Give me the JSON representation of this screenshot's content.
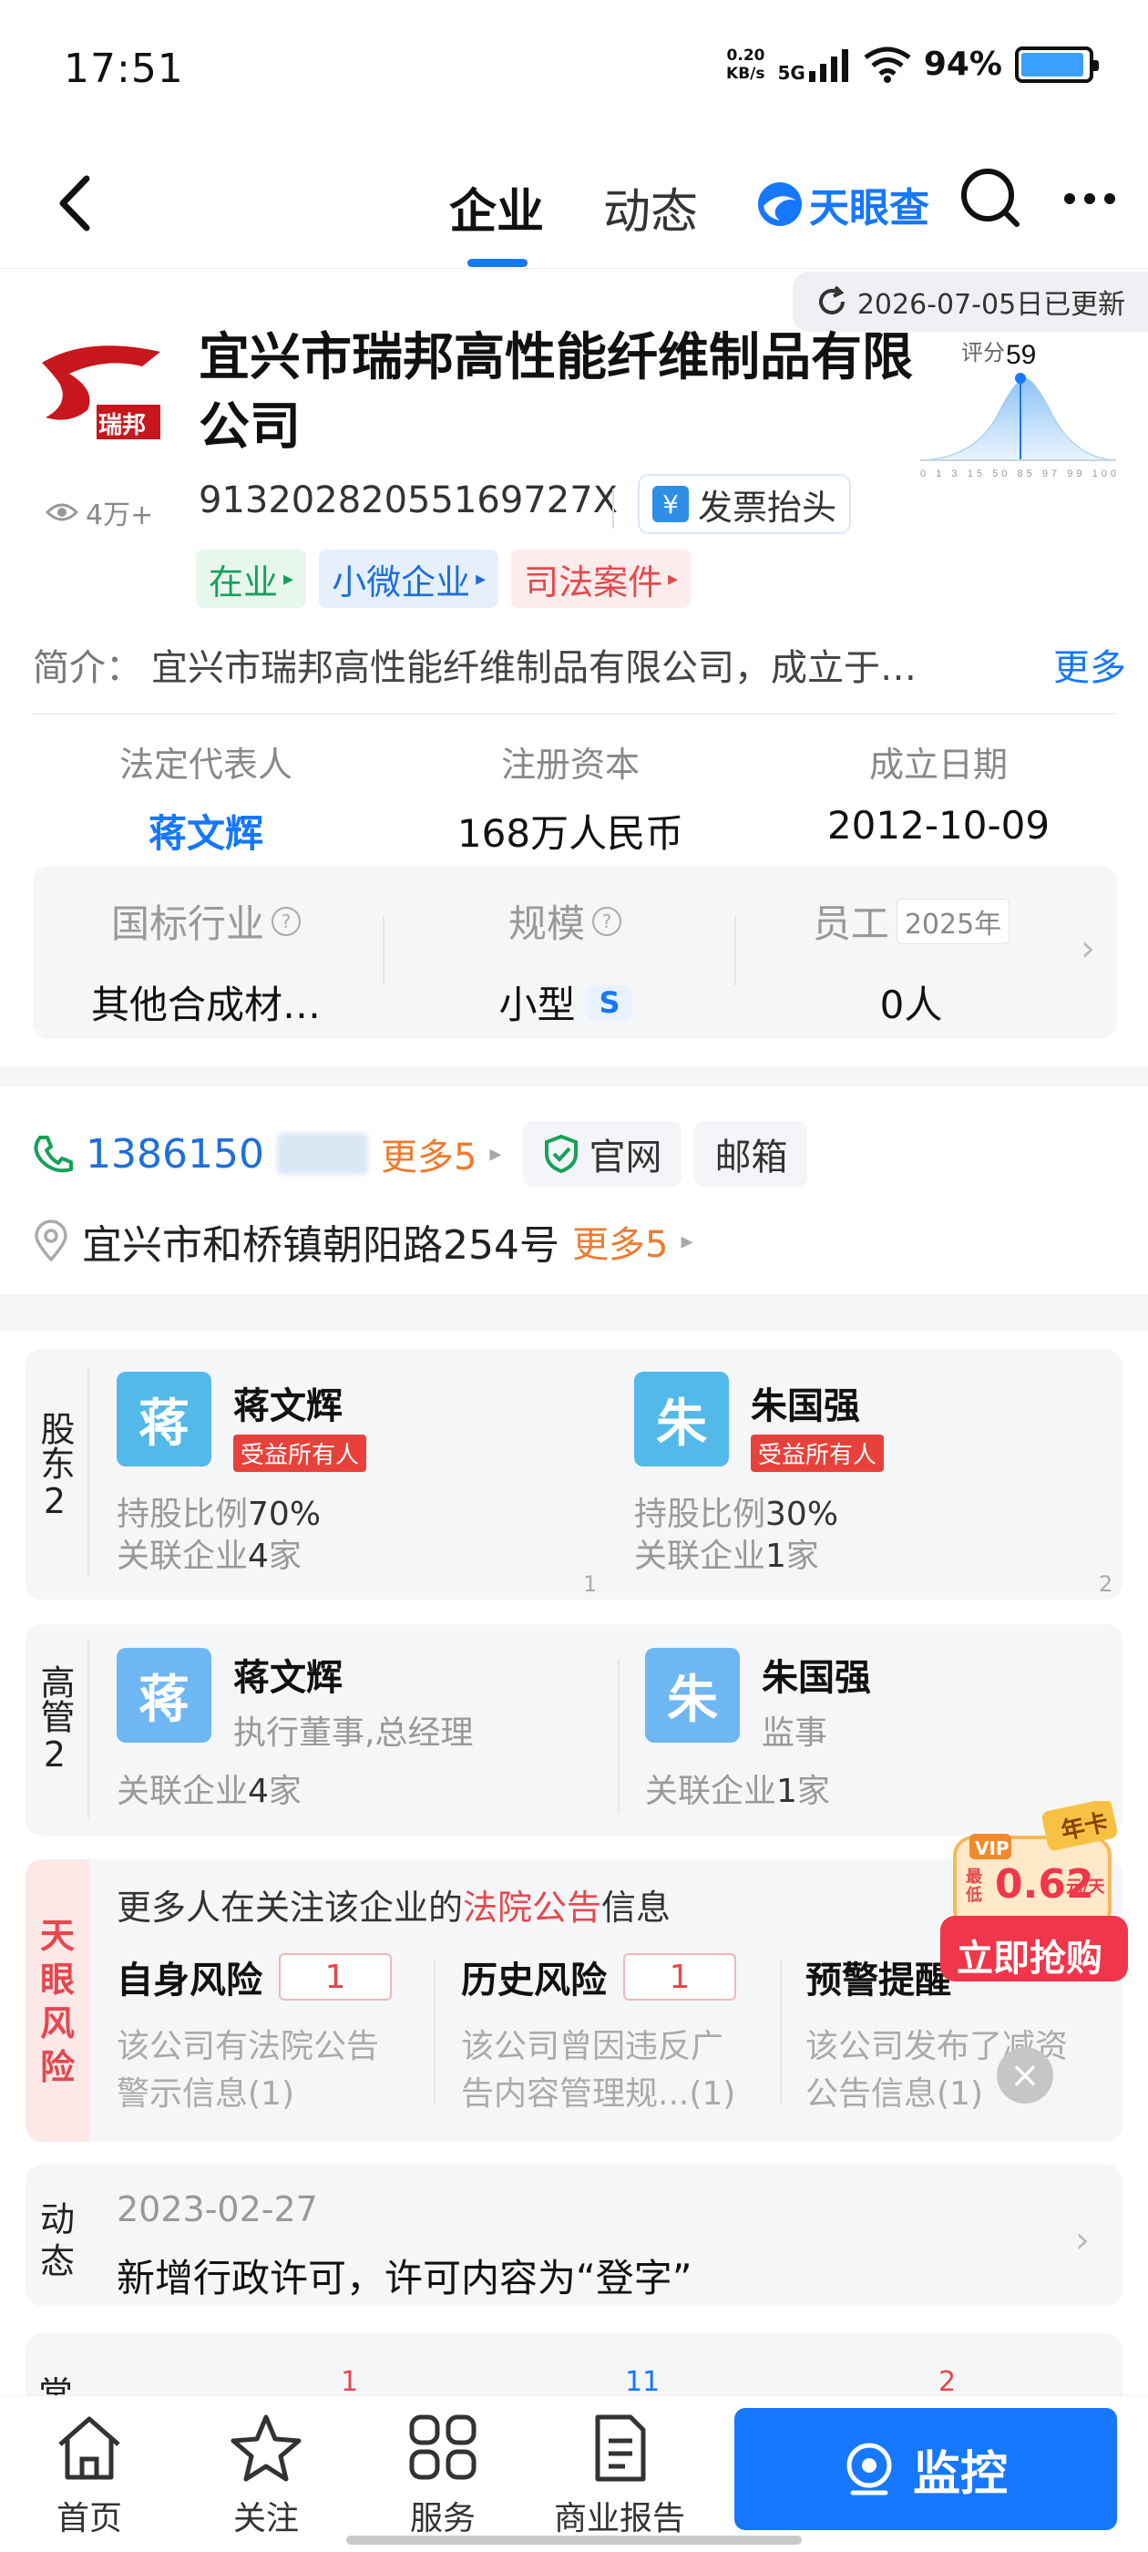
{
  "status": {
    "time": "17:51",
    "net_speed_top": "0.20",
    "net_speed_bottom": "KB/s",
    "signal": "5G",
    "battery": "94%",
    "battery_level": 0.94
  },
  "nav": {
    "tabs": [
      {
        "label": "企业"
      },
      {
        "label": "动态"
      }
    ],
    "brand": "天眼查"
  },
  "company": {
    "updated": "2026-07-05日已更新",
    "name": "宜兴市瑞邦高性能纤维制品有限公司",
    "logo_text": "瑞邦",
    "views": "4万+",
    "credit_code": "913202820551697 27X",
    "credit_code_display": "9132028205516972 7X",
    "credit": "91320282055169727X",
    "invoice_label": "发票抬头",
    "score_label": "评分",
    "score": "59",
    "score_ticks": "0 1 3 15 50 85 97 99 100",
    "tags": [
      {
        "label": "在业",
        "color": "#17a05a"
      },
      {
        "label": "小微企业",
        "color": "#1e6fd9"
      },
      {
        "label": "司法案件",
        "color": "#e5484d"
      }
    ],
    "intro_label": "简介：",
    "intro_text": "宜兴市瑞邦高性能纤维制品有限公司，成立于…",
    "intro_more": "更多",
    "legal_rep_label": "法定代表人",
    "legal_rep": "蒋文辉",
    "capital_label": "注册资本",
    "capital": "168万人民币",
    "founded_label": "成立日期",
    "founded": "2012-10-09",
    "industry_label": "国标行业",
    "industry": "其他合成材…",
    "scale_label": "规模",
    "scale": "小型",
    "scale_badge": "S",
    "staff_label": "员工",
    "staff_year": "2025年",
    "staff": "0人"
  },
  "contact": {
    "phone": "1386150",
    "phone_more": "更多5",
    "website": "官网",
    "email": "邮箱",
    "address": "宜兴市和桥镇朝阳路254号",
    "address_more": "更多5"
  },
  "shareholders": {
    "label": "股东",
    "count": "2",
    "items": [
      {
        "avatar": "蒋",
        "name": "蒋文辉",
        "badge": "受益所有人",
        "ratio_label": "持股比例",
        "ratio": "70%",
        "rel_label": "关联企业",
        "rel": "4",
        "rel_unit": "家",
        "index": "1"
      },
      {
        "avatar": "朱",
        "name": "朱国强",
        "badge": "受益所有人",
        "ratio_label": "持股比例",
        "ratio": "30%",
        "rel_label": "关联企业",
        "rel": "1",
        "rel_unit": "家",
        "index": "2"
      }
    ]
  },
  "executives": {
    "label": "高管",
    "count": "2",
    "items": [
      {
        "avatar": "蒋",
        "name": "蒋文辉",
        "role": "执行董事,总经理",
        "rel_label": "关联企业",
        "rel": "4",
        "rel_unit": "家"
      },
      {
        "avatar": "朱",
        "name": "朱国强",
        "role": "监事",
        "rel_label": "关联企业",
        "rel": "1",
        "rel_unit": "家"
      }
    ]
  },
  "risk": {
    "side_label": "天眼风险",
    "head_prefix": "更多人在关注该企业的",
    "head_highlight": "法院公告",
    "head_suffix": "信息",
    "cols": [
      {
        "title": "自身风险",
        "count": "1",
        "desc1": "该公司有法院公告",
        "desc2": "警示信息(1)"
      },
      {
        "title": "历史风险",
        "count": "1",
        "desc1": "该公司曾因违反广",
        "desc2": "告内容管理规...(1)"
      },
      {
        "title": "预警提醒",
        "count": "",
        "desc1": "该公司发布了减资",
        "desc2": "公告信息(1)"
      }
    ]
  },
  "promo": {
    "card": "年卡",
    "vip": "VIP",
    "lowest": "最低",
    "price": "0.62",
    "unit": "元/天",
    "cta": "立即抢购"
  },
  "dynamic": {
    "label": "动态",
    "date": "2023-02-27",
    "text": "新增行政许可，许可内容为“登字”"
  },
  "peek": {
    "label": "常",
    "n1": "1",
    "n2": "11",
    "n3": "2"
  },
  "tabbar": {
    "items": [
      {
        "label": "首页",
        "icon": "home-icon"
      },
      {
        "label": "关注",
        "icon": "star-icon"
      },
      {
        "label": "服务",
        "icon": "grid-icon"
      },
      {
        "label": "商业报告",
        "icon": "report-icon"
      }
    ],
    "monitor": "监控"
  },
  "colors": {
    "primary": "#1677ff",
    "risk": "#e5484d",
    "orange": "#ef7a2f"
  }
}
